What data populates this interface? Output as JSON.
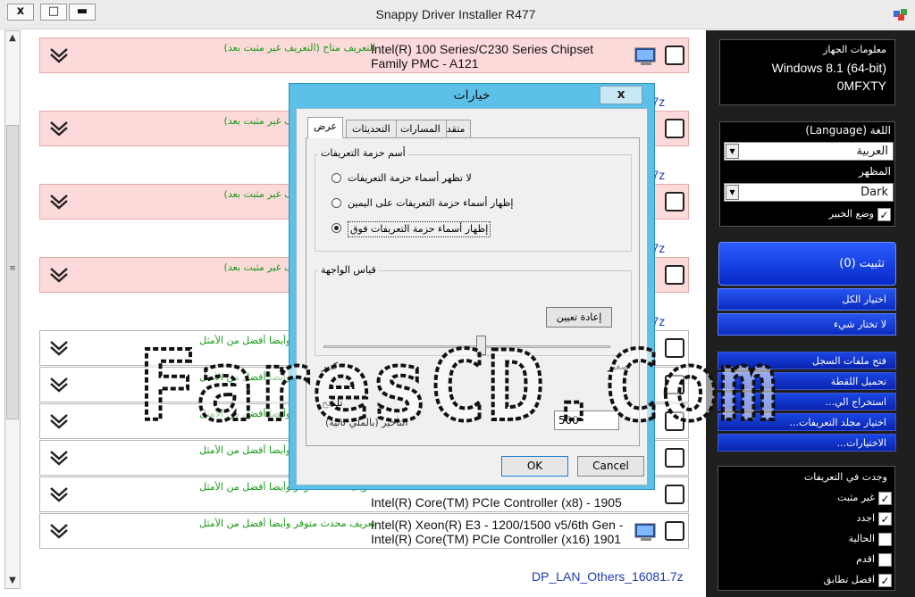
{
  "window": {
    "title": "Snappy Driver Installer R477",
    "close_glyph": "x",
    "max_glyph": "□",
    "min_glyph": "▬"
  },
  "drivers": {
    "rows": [
      {
        "status": "التعريف متاح (التعريف غير مثبت بعد)",
        "name": "Intel(R) 100 Series/C230 Series Chipset Family PMC - A121"
      },
      {
        "status": "التعريف متاح (التعريف غير مثبت بعد)",
        "name": ""
      },
      {
        "status": "التعريف متاح (التعريف غير مثبت بعد)",
        "name": ""
      },
      {
        "status": "التعريف متاح (التعريف غير مثبت بعد)",
        "name": ""
      },
      {
        "status": "تعريف محدث متوفر وأيضا أفضل من الأمثل",
        "name": ""
      },
      {
        "status": "تعريف محدث متوفر وأيضا أفضل من الأمثل",
        "name": ""
      },
      {
        "status": "تعريف محدث متوفر وأيضا أفضل من الأمثل",
        "name": ""
      },
      {
        "status": "تعريف محدث متوفر وأيضا أفضل من الأمثل",
        "name": ""
      },
      {
        "status": "تعريف محدث متوفر وأيضا أفضل من الأمثل",
        "name": "Intel(R) Core(TM) PCIe Controller (x8) - 1905"
      },
      {
        "status": "تعريف محدث متوفر وأيضا أفضل من الأمثل",
        "name": "Intel(R) Xeon(R) E3 - 1200/1500 v5/6th Gen - Intel(R) Core(TM) PCIe Controller (x16) 1901"
      }
    ],
    "group_labels": [
      "81.7z",
      "55.7z",
      "75.7z",
      "81.7z"
    ],
    "bottom_label": "DP_LAN_Others_16081.7z"
  },
  "sidebar": {
    "info_title": "معلومات الجهاز",
    "os": "Windows 8.1 (64-bit)",
    "pc_name": "0MFXTY",
    "language_label": "اللغة (Language)",
    "language_value": "العربية",
    "theme_label": "المظهر",
    "theme_value": "Dark",
    "expert_label": "وضع الخبير",
    "install_label": "تثبيت (0)",
    "select_all": "اختيار الكل",
    "select_none": "لا تختار شيء",
    "menu": [
      "فتح ملفات السجل",
      "تحميل اللقطة",
      "استخراج الي...",
      "اختيار مجلد التعريفات...",
      "الاختيارات..."
    ],
    "filter_title": "وجدت في التعريفات",
    "filters": [
      {
        "label": "غير مثبت",
        "checked": true
      },
      {
        "label": "اجدد",
        "checked": true
      },
      {
        "label": "الحالية",
        "checked": false
      },
      {
        "label": "اقدم",
        "checked": false
      },
      {
        "label": "افضل تطابق",
        "checked": true
      }
    ]
  },
  "dialog": {
    "title": "خيارات",
    "close_glyph": "x",
    "tabs": [
      "عرض",
      "التحديثات",
      "المسارات",
      "متقدم"
    ],
    "group_names_title": "أسم حزمة التعريفات",
    "radios": [
      {
        "label": "لا تظهر أسماء حزمة التعريفات",
        "selected": false
      },
      {
        "label": "إظهار أسماء حزمة التعريفات على اليمين",
        "selected": false
      },
      {
        "label": "إظهار أسماء حزمة التعريفات فوق",
        "selected": true
      }
    ],
    "ui_scale_title": "قياس الواجهة",
    "reset_label": "إعادة تعيين",
    "slider_value": 0.55,
    "slider_min": "صغير",
    "slider_max": "كبير",
    "delay_title": "تلميح",
    "delay_label": "التأخير (بالملي ثانية)",
    "delay_value": "500",
    "ok": "OK",
    "cancel": "Cancel"
  },
  "watermark": {
    "text": "FaresCD.Com"
  }
}
